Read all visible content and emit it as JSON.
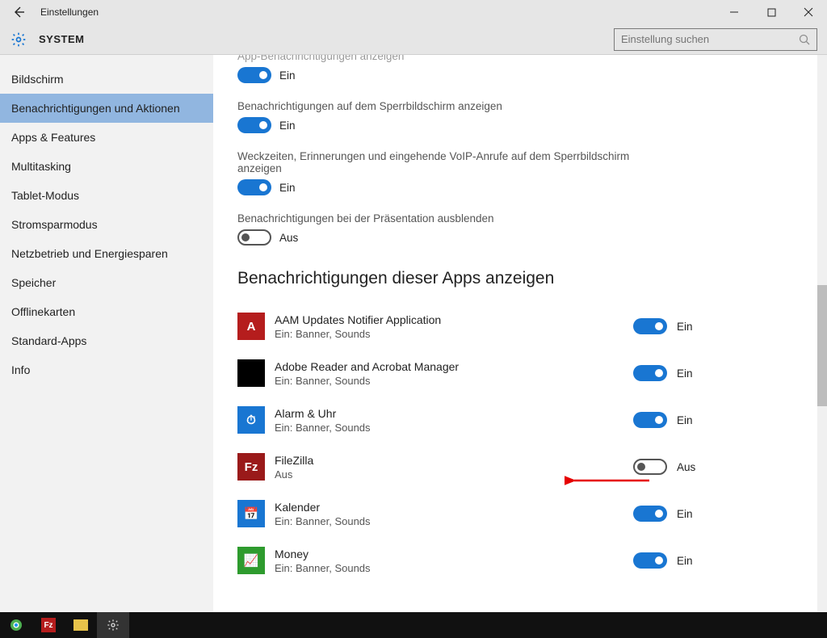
{
  "window": {
    "title": "Einstellungen",
    "section": "SYSTEM"
  },
  "search": {
    "placeholder": "Einstellung suchen"
  },
  "sidebar": {
    "items": [
      {
        "label": "Bildschirm"
      },
      {
        "label": "Benachrichtigungen und Aktionen",
        "selected": true
      },
      {
        "label": "Apps & Features"
      },
      {
        "label": "Multitasking"
      },
      {
        "label": "Tablet-Modus"
      },
      {
        "label": "Stromsparmodus"
      },
      {
        "label": "Netzbetrieb und Energiesparen"
      },
      {
        "label": "Speicher"
      },
      {
        "label": "Offlinekarten"
      },
      {
        "label": "Standard-Apps"
      },
      {
        "label": "Info"
      }
    ]
  },
  "toggles": {
    "truncated": {
      "label": "App-Benachrichtigungen anzeigen",
      "state": "Ein",
      "on": true
    },
    "lockscreen": {
      "label": "Benachrichtigungen auf dem Sperrbildschirm anzeigen",
      "state": "Ein",
      "on": true
    },
    "alarms_lock": {
      "label": "Weckzeiten, Erinnerungen und eingehende VoIP-Anrufe auf dem Sperrbildschirm anzeigen",
      "state": "Ein",
      "on": true
    },
    "presentation": {
      "label": "Benachrichtigungen bei der Präsentation ausblenden",
      "state": "Aus",
      "on": false
    }
  },
  "apps_section_title": "Benachrichtigungen dieser Apps anzeigen",
  "app_state": {
    "on": "Ein",
    "off": "Aus"
  },
  "apps": [
    {
      "name": "AAM Updates Notifier Application",
      "sub": "Ein: Banner, Sounds",
      "on": true,
      "icon_bg": "#b51d1d",
      "icon_txt": "A"
    },
    {
      "name": "Adobe Reader and Acrobat Manager",
      "sub": "Ein: Banner, Sounds",
      "on": true,
      "icon_bg": "#000000",
      "icon_txt": ""
    },
    {
      "name": "Alarm & Uhr",
      "sub": "Ein: Banner, Sounds",
      "on": true,
      "icon_bg": "#1976d2",
      "icon_txt": "⏱"
    },
    {
      "name": "FileZilla",
      "sub": "Aus",
      "on": false,
      "icon_bg": "#9a1a1a",
      "icon_txt": "Fz",
      "annotated": true
    },
    {
      "name": "Kalender",
      "sub": "Ein: Banner, Sounds",
      "on": true,
      "icon_bg": "#1976d2",
      "icon_txt": "📅"
    },
    {
      "name": "Money",
      "sub": "Ein: Banner, Sounds",
      "on": true,
      "icon_bg": "#2e9b2e",
      "icon_txt": "📈"
    }
  ],
  "taskbar": {
    "items": [
      {
        "name": "chrome",
        "color": "#ffffff"
      },
      {
        "name": "filezilla",
        "color": "#d33"
      },
      {
        "name": "explorer",
        "color": "#e8c34a"
      },
      {
        "name": "settings",
        "color": "#bbb"
      }
    ]
  }
}
